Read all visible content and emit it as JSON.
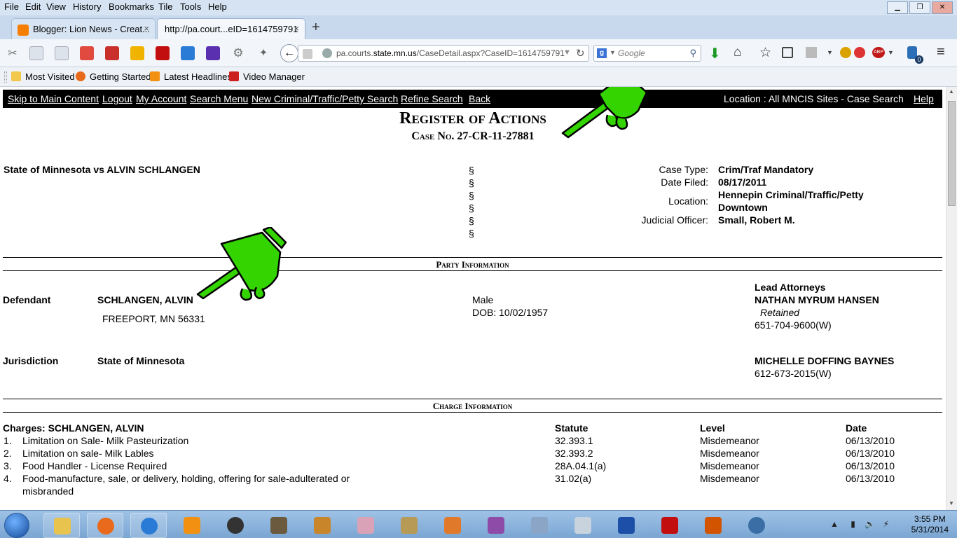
{
  "menu": [
    "File",
    "Edit",
    "View",
    "History",
    "Bookmarks",
    "Tile",
    "Tools",
    "Help"
  ],
  "tabs": [
    {
      "title": "Blogger: Lion News - Creat...",
      "close": "×"
    },
    {
      "title": "http://pa.court...eID=1614759791",
      "close": "×"
    }
  ],
  "new_tab": "+",
  "url": {
    "host_prefix": "pa.courts.",
    "host_domain": "state.mn.us",
    "path": "/CaseDetail.aspx?CaseID=1614759791"
  },
  "search": {
    "placeholder": "Google",
    "engine_icon": "g"
  },
  "bookmarks": [
    "Most Visited",
    "Getting Started",
    "Latest Headlines",
    "Video Manager"
  ],
  "addon_badge": "0",
  "topnav": {
    "links": [
      "Skip to Main Content",
      "Logout",
      "My Account",
      "Search Menu",
      "New Criminal/Traffic/Petty Search",
      "Refine Search",
      "Back"
    ],
    "location": "Location : All MNCIS Sites - Case Search",
    "help": "Help"
  },
  "heading": {
    "title": "Register of Actions",
    "case_no": "Case No. 27-CR-11-27881"
  },
  "case": {
    "style": "State of Minnesota vs ALVIN SCHLANGEN",
    "section_marks": [
      "§",
      "§",
      "§",
      "§",
      "§",
      "§"
    ],
    "fields": [
      {
        "label": "Case Type:",
        "value": "Crim/Traf Mandatory"
      },
      {
        "label": "Date Filed:",
        "value": "08/17/2011"
      },
      {
        "label": "Location:",
        "value": "Hennepin Criminal/Traffic/Petty",
        "value2": "Downtown"
      },
      {
        "label": "Judicial Officer:",
        "value": "Small, Robert M."
      }
    ]
  },
  "party": {
    "section_title": "Party Information",
    "lead_attorneys_label": "Lead Attorneys",
    "defendant": {
      "role": "Defendant",
      "name": "SCHLANGEN, ALVIN",
      "address": "FREEPORT, MN 56331",
      "sex": "Male",
      "dob": "DOB: 10/02/1957",
      "attorney": "NATHAN MYRUM HANSEN",
      "attorney_status": "Retained",
      "attorney_phone": "651-704-9600(W)"
    },
    "jurisdiction": {
      "role": "Jurisdiction",
      "name": "State of Minnesota",
      "attorney": "MICHELLE DOFFING BAYNES",
      "attorney_phone": "612-673-2015(W)"
    }
  },
  "charges": {
    "section_title": "Charge Information",
    "header": {
      "charges": "Charges: SCHLANGEN, ALVIN",
      "statute": "Statute",
      "level": "Level",
      "date": "Date"
    },
    "rows": [
      {
        "num": "1.",
        "desc": "Limitation on Sale- Milk Pasteurization",
        "desc2": "",
        "statute": "32.393.1",
        "level": "Misdemeanor",
        "date": "06/13/2010"
      },
      {
        "num": "2.",
        "desc": "Limitation on sale- Milk Lables",
        "desc2": "",
        "statute": "32.393.2",
        "level": "Misdemeanor",
        "date": "06/13/2010"
      },
      {
        "num": "3.",
        "desc": "Food Handler - License Required",
        "desc2": "",
        "statute": "28A.04.1(a)",
        "level": "Misdemeanor",
        "date": "06/13/2010"
      },
      {
        "num": "4.",
        "desc": "Food-manufacture, sale, or delivery, holding, offering for sale-adulterated or",
        "desc2": "misbranded",
        "statute": "31.02(a)",
        "level": "Misdemeanor",
        "date": "06/13/2010"
      }
    ]
  },
  "taskbar": {
    "time": "3:55 PM",
    "date": "5/31/2014"
  },
  "colors": {
    "chrome_bg": "#d6e3f2",
    "nav_black": "#000000",
    "hand_green": "#33d400",
    "taskbar": "#8db4dd"
  }
}
